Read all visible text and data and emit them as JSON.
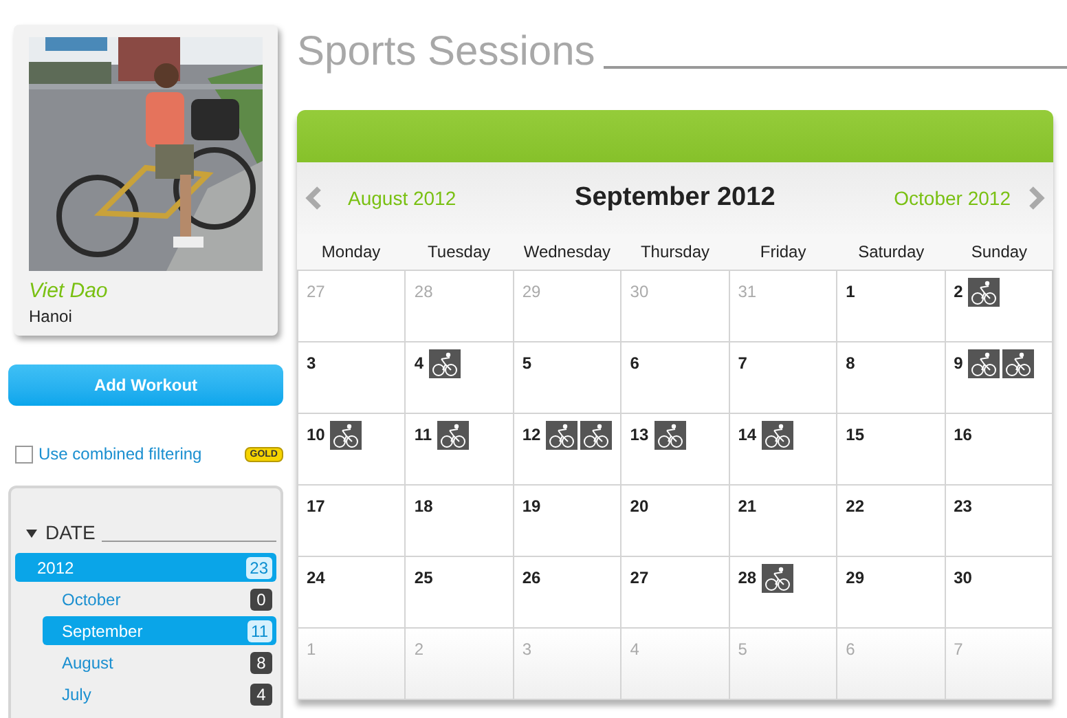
{
  "profile": {
    "name": "Viet Dao",
    "city": "Hanoi"
  },
  "add_button": "Add Workout",
  "filter": {
    "label": "Use combined filtering",
    "checked": false,
    "badge": "GOLD"
  },
  "date_filter": {
    "heading": "DATE",
    "expanded": true,
    "years": [
      {
        "label": "2012",
        "count": "23",
        "selected": true,
        "children": [
          {
            "label": "October",
            "count": "0",
            "selected": false
          },
          {
            "label": "September",
            "count": "11",
            "selected": true
          },
          {
            "label": "August",
            "count": "8",
            "selected": false
          },
          {
            "label": "July",
            "count": "4",
            "selected": false
          }
        ]
      }
    ]
  },
  "title": "Sports Sessions",
  "calendar": {
    "prev": "August 2012",
    "month": "September 2012",
    "next": "October 2012",
    "weekdays": [
      "Monday",
      "Tuesday",
      "Wednesday",
      "Thursday",
      "Friday",
      "Saturday",
      "Sunday"
    ],
    "weeks": [
      [
        {
          "day": "27",
          "in_month": false
        },
        {
          "day": "28",
          "in_month": false
        },
        {
          "day": "29",
          "in_month": false
        },
        {
          "day": "30",
          "in_month": false
        },
        {
          "day": "31",
          "in_month": false
        },
        {
          "day": "1",
          "in_month": true
        },
        {
          "day": "2",
          "in_month": true,
          "activities": [
            {
              "kind": "cycling"
            }
          ]
        }
      ],
      [
        {
          "day": "3",
          "in_month": true
        },
        {
          "day": "4",
          "in_month": true,
          "activities": [
            {
              "kind": "cycling"
            }
          ]
        },
        {
          "day": "5",
          "in_month": true
        },
        {
          "day": "6",
          "in_month": true
        },
        {
          "day": "7",
          "in_month": true
        },
        {
          "day": "8",
          "in_month": true
        },
        {
          "day": "9",
          "in_month": true,
          "activities": [
            {
              "kind": "cycling"
            },
            {
              "kind": "cycling"
            }
          ]
        }
      ],
      [
        {
          "day": "10",
          "in_month": true,
          "activities": [
            {
              "kind": "cycling"
            }
          ]
        },
        {
          "day": "11",
          "in_month": true,
          "activities": [
            {
              "kind": "cycling"
            }
          ]
        },
        {
          "day": "12",
          "in_month": true,
          "activities": [
            {
              "kind": "cycling"
            },
            {
              "kind": "cycling"
            }
          ]
        },
        {
          "day": "13",
          "in_month": true,
          "activities": [
            {
              "kind": "cycling"
            }
          ]
        },
        {
          "day": "14",
          "in_month": true,
          "activities": [
            {
              "kind": "cycling"
            }
          ]
        },
        {
          "day": "15",
          "in_month": true
        },
        {
          "day": "16",
          "in_month": true
        }
      ],
      [
        {
          "day": "17",
          "in_month": true
        },
        {
          "day": "18",
          "in_month": true
        },
        {
          "day": "19",
          "in_month": true
        },
        {
          "day": "20",
          "in_month": true
        },
        {
          "day": "21",
          "in_month": true
        },
        {
          "day": "22",
          "in_month": true
        },
        {
          "day": "23",
          "in_month": true
        }
      ],
      [
        {
          "day": "24",
          "in_month": true
        },
        {
          "day": "25",
          "in_month": true
        },
        {
          "day": "26",
          "in_month": true
        },
        {
          "day": "27",
          "in_month": true
        },
        {
          "day": "28",
          "in_month": true,
          "activities": [
            {
              "kind": "cycling"
            }
          ]
        },
        {
          "day": "29",
          "in_month": true
        },
        {
          "day": "30",
          "in_month": true
        }
      ],
      [
        {
          "day": "1",
          "in_month": false
        },
        {
          "day": "2",
          "in_month": false
        },
        {
          "day": "3",
          "in_month": false
        },
        {
          "day": "4",
          "in_month": false
        },
        {
          "day": "5",
          "in_month": false
        },
        {
          "day": "6",
          "in_month": false
        },
        {
          "day": "7",
          "in_month": false
        }
      ]
    ]
  }
}
